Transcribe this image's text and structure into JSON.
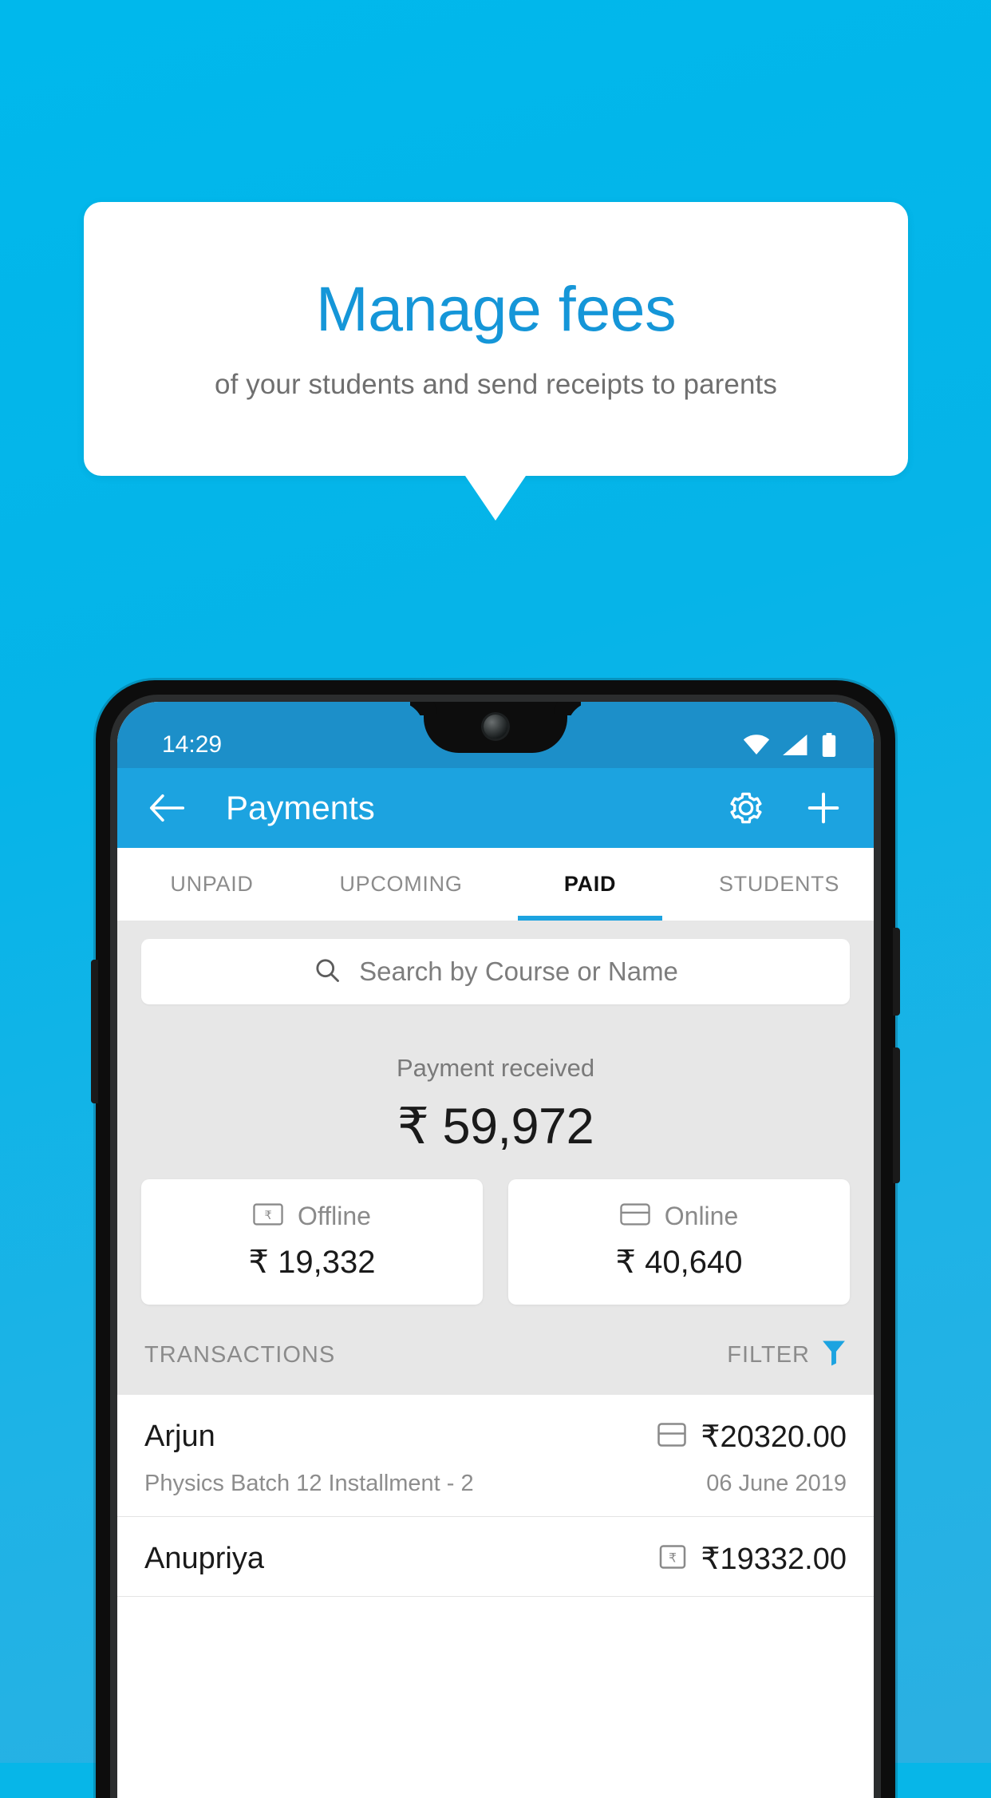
{
  "promo": {
    "title": "Manage fees",
    "subtitle": "of your students and send receipts to parents"
  },
  "colors": {
    "background": "#07b6e8",
    "brand": "#1ca3e0",
    "promo_title": "#1596d8",
    "status_bar": "#1c8fc9",
    "body_grey": "#e7e7e7",
    "filter_icon": "#1ca3e0"
  },
  "phone": {
    "status_bar": {
      "time": "14:29",
      "icons": [
        "wifi-icon",
        "signal-icon",
        "battery-icon"
      ]
    },
    "app_bar": {
      "back_icon": "back-arrow-icon",
      "title": "Payments",
      "settings_icon": "gear-icon",
      "add_icon": "plus-icon"
    },
    "tabs": [
      {
        "label": "UNPAID",
        "active": false
      },
      {
        "label": "UPCOMING",
        "active": false
      },
      {
        "label": "PAID",
        "active": true
      },
      {
        "label": "STUDENTS",
        "active": false
      }
    ],
    "search": {
      "icon": "search-icon",
      "placeholder": "Search by Course or Name",
      "value": ""
    },
    "summary": {
      "label": "Payment received",
      "amount": "₹ 59,972"
    },
    "methods": [
      {
        "icon": "cash-rupee-icon",
        "label": "Offline",
        "amount": "₹ 19,332"
      },
      {
        "icon": "credit-card-icon",
        "label": "Online",
        "amount": "₹ 40,640"
      }
    ],
    "transactions_header": {
      "title": "TRANSACTIONS",
      "filter_label": "FILTER",
      "filter_icon": "funnel-icon"
    },
    "transactions": [
      {
        "name": "Arjun",
        "description": "Physics Batch 12 Installment - 2",
        "amount": "₹20320.00",
        "date": "06 June 2019",
        "method_icon": "credit-card-icon"
      },
      {
        "name": "Anupriya",
        "description": "",
        "amount": "₹19332.00",
        "date": "",
        "method_icon": "cash-rupee-icon"
      }
    ]
  }
}
